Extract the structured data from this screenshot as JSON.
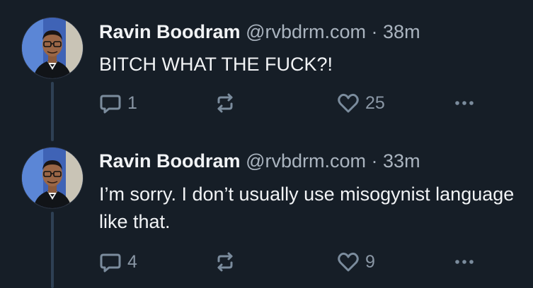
{
  "theme": {
    "background": "#161e27",
    "text": "#f1f3f5",
    "muted": "#aab4bf",
    "icon": "#7b8c9d",
    "thread_line": "#2e4054"
  },
  "posts": [
    {
      "author": {
        "display_name": "Ravin Boodram",
        "handle": "@rvbdrm.com",
        "avatar_icon": "user-avatar"
      },
      "separator": "·",
      "time": "38m",
      "text": "BITCH WHAT THE FUCK?!",
      "actions": {
        "reply_icon": "reply-icon",
        "reply_count": "1",
        "repost_icon": "repost-icon",
        "like_icon": "heart-icon",
        "like_count": "25",
        "more_icon": "more-icon"
      }
    },
    {
      "author": {
        "display_name": "Ravin Boodram",
        "handle": "@rvbdrm.com",
        "avatar_icon": "user-avatar"
      },
      "separator": "·",
      "time": "33m",
      "text": "I’m sorry. I don’t usually use misogynist language like that.",
      "actions": {
        "reply_icon": "reply-icon",
        "reply_count": "4",
        "repost_icon": "repost-icon",
        "like_icon": "heart-icon",
        "like_count": "9",
        "more_icon": "more-icon"
      }
    }
  ]
}
